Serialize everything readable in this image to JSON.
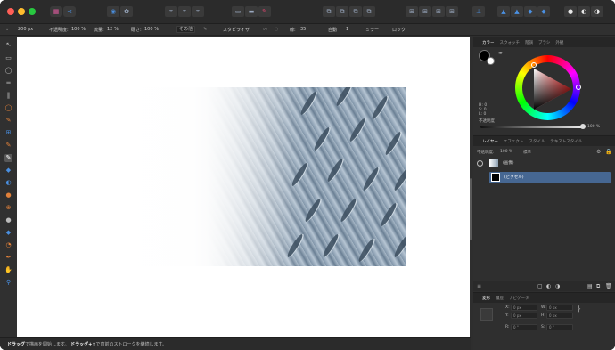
{
  "window": {
    "traffic": [
      "#ff5f57",
      "#febc2e",
      "#28c840"
    ]
  },
  "context_bar": {
    "width_value": "200 px",
    "opacity_label": "不透明度:",
    "opacity_value": "100 %",
    "flow_label": "流量:",
    "flow_value": "12 %",
    "hardness_label": "硬さ:",
    "hardness_value": "100 %",
    "other_label": "その他",
    "stabilizer_label": "スタビライザ",
    "mode_label": "線:",
    "mode_value": "35",
    "source_label": "自動",
    "source_value": "1",
    "mirror_label": "ミラー",
    "lock_label": "ロック"
  },
  "color_panel": {
    "tabs": [
      "カラー",
      "スウォッチ",
      "階調",
      "ブラシ",
      "外観"
    ],
    "hsl": [
      "H: 0",
      "S: 0",
      "L: 0"
    ],
    "opacity_label": "不透明度",
    "opacity_value": "100 %",
    "accent": "#ff3030"
  },
  "layers_panel": {
    "tabs": [
      "レイヤー",
      "エフェクト",
      "スタイル",
      "テキストスタイル"
    ],
    "opacity_label": "不透明度:",
    "opacity_value": "100 %",
    "blend_value": "標準",
    "layers": [
      {
        "name": "(画像)",
        "selected": false
      },
      {
        "name": "(ピクセル)",
        "selected": true
      }
    ]
  },
  "transform_panel": {
    "tabs": [
      "変形",
      "履歴",
      "ナビゲータ"
    ],
    "x_label": "X:",
    "x_value": "0 px",
    "y_label": "Y:",
    "y_value": "0 px",
    "w_label": "W:",
    "w_value": "0 px",
    "h_label": "H:",
    "h_value": "0 px",
    "r_label": "R:",
    "r_value": "0 °",
    "s_label": "S:",
    "s_value": "0 °"
  },
  "status": {
    "text_bold_1": "ドラッグ",
    "text_1": "で描画を開始します。",
    "text_bold_2": "ドラッグ+⇧",
    "text_2": "で直前のストロークを継続します。"
  }
}
